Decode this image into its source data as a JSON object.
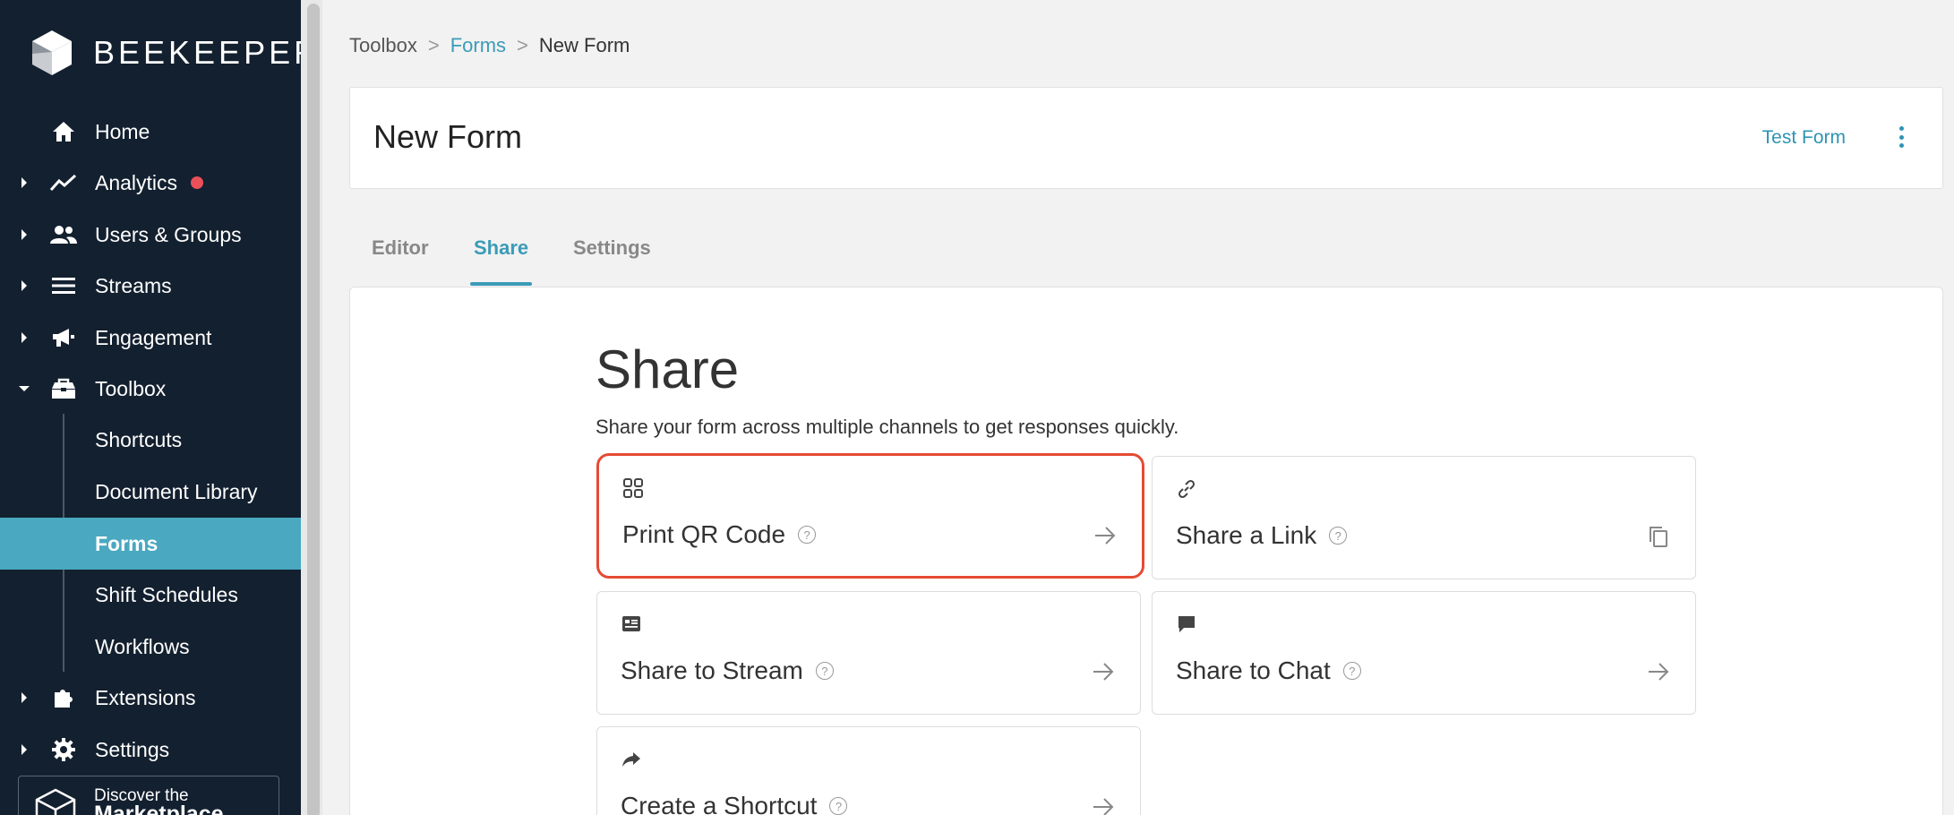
{
  "brand": {
    "name": "BEEKEEPER"
  },
  "sidebar": {
    "items": [
      {
        "label": "Home",
        "icon": "home-icon",
        "expandable": false
      },
      {
        "label": "Analytics",
        "icon": "analytics-icon",
        "expandable": true,
        "badge": "notification-dot"
      },
      {
        "label": "Users & Groups",
        "icon": "users-icon",
        "expandable": true
      },
      {
        "label": "Streams",
        "icon": "streams-icon",
        "expandable": true
      },
      {
        "label": "Engagement",
        "icon": "megaphone-icon",
        "expandable": true
      },
      {
        "label": "Toolbox",
        "icon": "toolbox-icon",
        "expandable": true,
        "expanded": true
      },
      {
        "label": "Extensions",
        "icon": "puzzle-icon",
        "expandable": true
      },
      {
        "label": "Settings",
        "icon": "gear-icon",
        "expandable": true
      }
    ],
    "toolbox_children": [
      {
        "label": "Shortcuts"
      },
      {
        "label": "Document Library"
      },
      {
        "label": "Forms",
        "active": true
      },
      {
        "label": "Shift Schedules"
      },
      {
        "label": "Workflows"
      }
    ],
    "marketplace": {
      "line1": "Discover the",
      "line2": "Marketplace"
    },
    "colors": {
      "background": "#13202f",
      "active": "#4aa8c0",
      "badge": "#e9505a"
    }
  },
  "breadcrumb": {
    "items": [
      "Toolbox",
      "Forms",
      "New Form"
    ],
    "separator": ">"
  },
  "header": {
    "title": "New Form",
    "test_form_label": "Test Form"
  },
  "tabs": [
    {
      "label": "Editor",
      "active": false
    },
    {
      "label": "Share",
      "active": true
    },
    {
      "label": "Settings",
      "active": false
    }
  ],
  "share": {
    "title": "Share",
    "subtitle": "Share your form across multiple channels to get responses quickly.",
    "options": [
      {
        "label": "Print QR Code",
        "icon": "qr-code-icon",
        "action": "arrow-right-icon",
        "highlighted": true
      },
      {
        "label": "Share a Link",
        "icon": "link-icon",
        "action": "copy-icon"
      },
      {
        "label": "Share to Stream",
        "icon": "stream-post-icon",
        "action": "arrow-right-icon"
      },
      {
        "label": "Share to Chat",
        "icon": "chat-bubble-icon",
        "action": "arrow-right-icon"
      },
      {
        "label": "Create a Shortcut",
        "icon": "share-arrow-icon",
        "action": "arrow-right-icon"
      }
    ],
    "help_glyph": "?"
  },
  "colors": {
    "accent": "#3b9bb8",
    "highlight_border": "#e64a33"
  }
}
